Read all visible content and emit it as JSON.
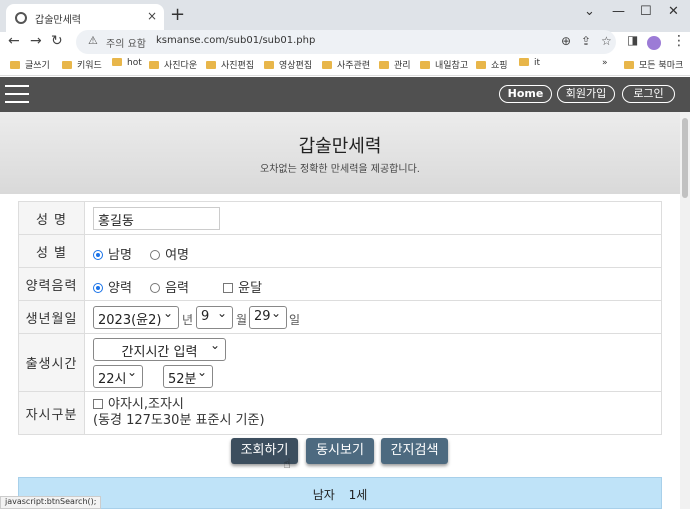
{
  "browser": {
    "tab_title": "갑술만세력",
    "url_info": "주의 요함",
    "url": "ksmanse.com/sub01/sub01.php",
    "new_tab": "+",
    "close": "×"
  },
  "bookmarks": [
    "글쓰기",
    "키워드",
    "hot",
    "사진다운",
    "사진편집",
    "영상편집",
    "사주관련",
    "관리",
    "내일참고",
    "쇼핑",
    "it"
  ],
  "bookmarks_more": "»",
  "bookmarks_all": "모든 북마크",
  "nav": {
    "home": "Home",
    "signup": "회원가입",
    "login": "로그인"
  },
  "banner": {
    "title": "갑술만세력",
    "subtitle": "오차없는 정확한 만세력을 제공합니다."
  },
  "form": {
    "name_label": "성 명",
    "name_value": "홍길동",
    "gender_label": "성 별",
    "male": "남명",
    "female": "여명",
    "gender_selected": "남명",
    "cal_label": "양력음력",
    "solar": "양력",
    "lunar": "음력",
    "leap": "윤달",
    "cal_selected": "양력",
    "birth_label": "생년월일",
    "year": "2023(윤2)",
    "year_unit": "년",
    "month": "9",
    "month_unit": "월",
    "day": "29",
    "day_unit": "일",
    "time_label": "출생시간",
    "time_mode": "간지시간 입력",
    "hour": "22시",
    "minute": "52분",
    "jasi_label": "자시구분",
    "jasi_option": "야자시,조자시",
    "jasi_note": "(동경 127도30분 표준시 기준)"
  },
  "buttons": {
    "search": "조회하기",
    "dongsi": "동시보기",
    "ganji": "간지검색"
  },
  "result": {
    "gender": "남자",
    "age": "1세"
  },
  "status_bar": "javascript:btnSearch();"
}
